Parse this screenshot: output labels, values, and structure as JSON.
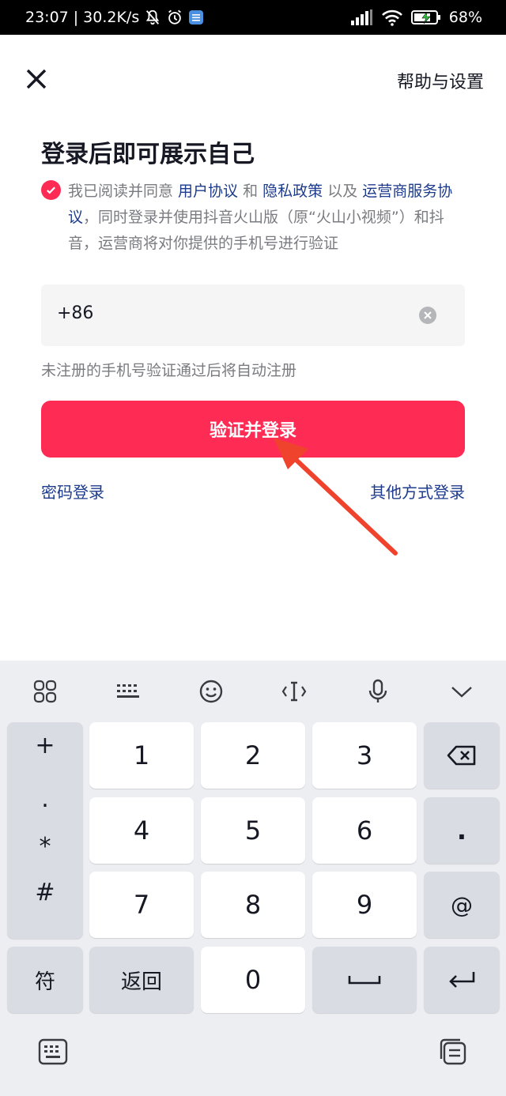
{
  "status_bar": {
    "time": "23:07",
    "speed": "30.2K/s",
    "battery": "68%"
  },
  "header": {
    "help_label": "帮助与设置"
  },
  "title": "登录后即可展示自己",
  "agreement": {
    "p1": "我已阅读并同意 ",
    "link_user": "用户协议",
    "p2": " 和 ",
    "link_privacy": "隐私政策",
    "p3": " 以及 ",
    "link_carrier": "运营商服务协议",
    "p4": "，同时登录并使用抖音火山版（原“火山小视频”）和抖音，运营商将对你提供的手机号进行验证"
  },
  "phone_input": {
    "prefix": "+86",
    "value": ""
  },
  "hint": "未注册的手机号验证通过后将自动注册",
  "login_button": "验证并登录",
  "password_login": "密码登录",
  "other_login": "其他方式登录",
  "colors": {
    "accent": "#fe2c55",
    "link": "#1d3b8c",
    "annotation_arrow": "#f0432e"
  },
  "keyboard": {
    "toolbar_icons": [
      "grid-icon",
      "keyboard-icon",
      "emoji-icon",
      "cursor-icon",
      "microphone-icon",
      "chevron-down-icon"
    ],
    "symbols": [
      "+",
      ".",
      "*",
      "#"
    ],
    "keys": {
      "k1": "1",
      "k2": "2",
      "k3": "3",
      "k4": "4",
      "k5": "5",
      "k6": "6",
      "k7": "7",
      "k8": "8",
      "k9": "9",
      "k0": "0",
      "dot": ".",
      "at": "@",
      "fu": "符",
      "back": "返回"
    }
  }
}
